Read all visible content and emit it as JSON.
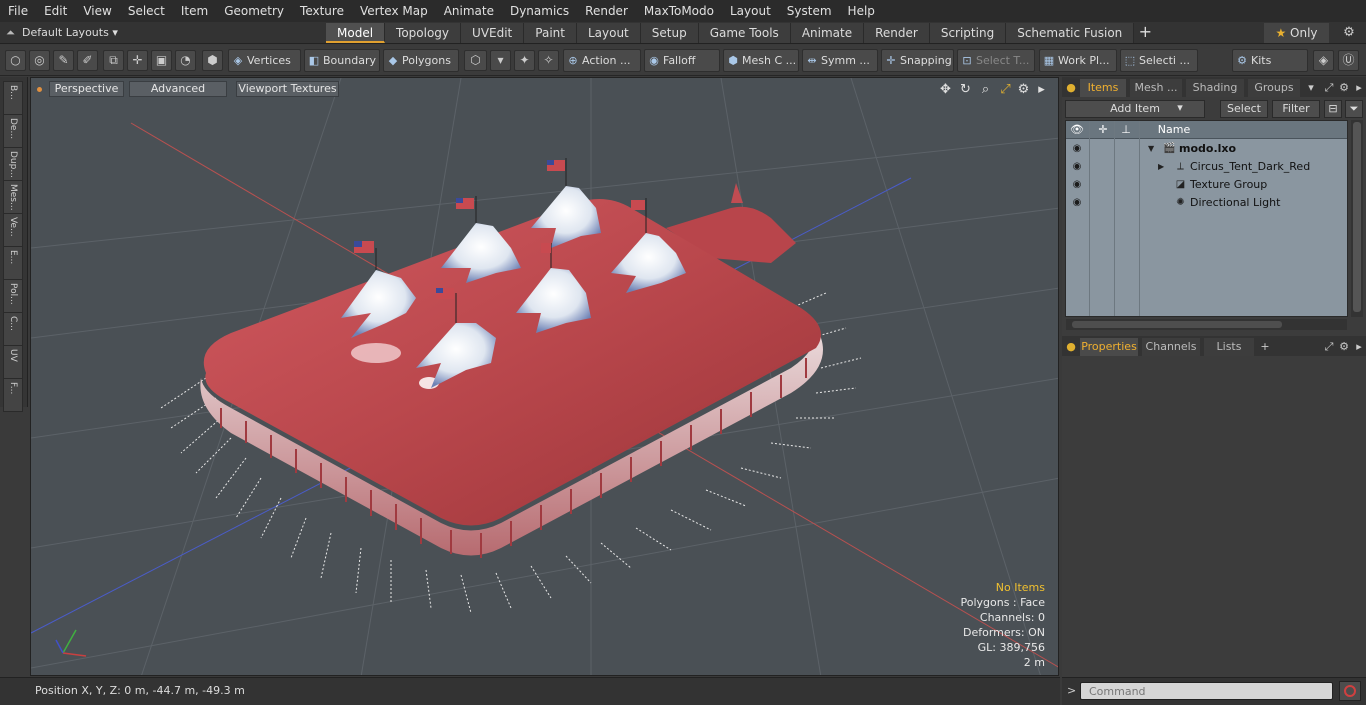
{
  "menu": [
    "File",
    "Edit",
    "View",
    "Select",
    "Item",
    "Geometry",
    "Texture",
    "Vertex Map",
    "Animate",
    "Dynamics",
    "Render",
    "MaxToModo",
    "Layout",
    "System",
    "Help"
  ],
  "layouts": {
    "label": "Default Layouts"
  },
  "tabs": [
    {
      "label": "Model",
      "active": true
    },
    {
      "label": "Topology"
    },
    {
      "label": "UVEdit"
    },
    {
      "label": "Paint"
    },
    {
      "label": "Layout"
    },
    {
      "label": "Setup"
    },
    {
      "label": "Game Tools"
    },
    {
      "label": "Animate"
    },
    {
      "label": "Render"
    },
    {
      "label": "Scripting"
    },
    {
      "label": "Schematic Fusion"
    }
  ],
  "only_label": "Only",
  "toolbar": {
    "vertices": "Vertices",
    "boundary": "Boundary",
    "polygons": "Polygons",
    "action": "Action ...",
    "falloff": "Falloff",
    "mesh": "Mesh C ...",
    "symm": "Symm ...",
    "snapping": "Snapping",
    "select_t": "Select T...",
    "workpl": "Work Pl...",
    "selecti": "Selecti ...",
    "kits": "Kits"
  },
  "left_tabs": [
    "B...",
    "De...",
    "Dup...",
    "Mes...",
    "Ve...",
    "E...",
    "Pol...",
    "C...",
    "UV",
    "F..."
  ],
  "viewport": {
    "perspective": "Perspective",
    "advanced": "Advanced",
    "textures": "Viewport Textures",
    "info": {
      "selection": "No Items",
      "polygons": "Polygons : Face",
      "channels": "Channels: 0",
      "deformers": "Deformers: ON",
      "gl": "GL: 389,756",
      "scale": "2 m"
    }
  },
  "right_tabs": {
    "items": "Items",
    "mesh": "Mesh ...",
    "shading": "Shading",
    "groups": "Groups"
  },
  "items_bar": {
    "add_item": "Add Item",
    "select": "Select",
    "filter": "Filter"
  },
  "item_list": {
    "name_header": "Name",
    "rows": [
      {
        "label": "modo.lxo",
        "icon": "scene-icon"
      },
      {
        "label": "Circus_Tent_Dark_Red",
        "icon": "mesh-icon"
      },
      {
        "label": "Texture Group",
        "icon": "texture-group-icon"
      },
      {
        "label": "Directional Light",
        "icon": "light-icon"
      }
    ]
  },
  "bottom_tabs": {
    "properties": "Properties",
    "channels": "Channels",
    "lists": "Lists"
  },
  "command": {
    "placeholder": "Command"
  },
  "status": {
    "position": "Position X, Y, Z:   0 m, -44.7 m, -49.3 m"
  }
}
